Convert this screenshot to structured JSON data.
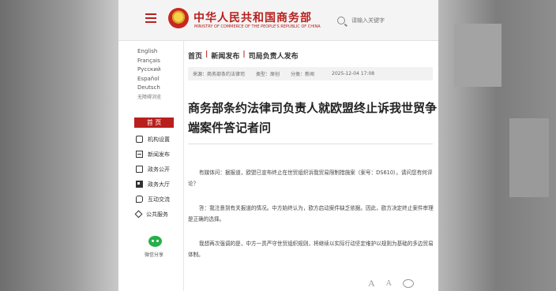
{
  "header": {
    "site_title": "中华人民共和国商务部",
    "site_subtitle": "MINISTRY OF COMMERCE OF THE PEOPLE'S REPUBLIC OF CHINA",
    "search_placeholder": "请输入关键字"
  },
  "languages": [
    "English",
    "Français",
    "Русский",
    "Español",
    "Deutsch",
    "无障碍浏览"
  ],
  "sidebar": {
    "home_label": "首 页",
    "items": [
      {
        "label": "机构设置",
        "icon": "org-icon"
      },
      {
        "label": "新闻发布",
        "icon": "news-icon"
      },
      {
        "label": "政务公开",
        "icon": "gov-icon"
      },
      {
        "label": "政务大厅",
        "icon": "hall-icon"
      },
      {
        "label": "互动交流",
        "icon": "chat-icon"
      },
      {
        "label": "公共服务",
        "icon": "public-icon"
      }
    ],
    "wechat_label": "微信分享"
  },
  "breadcrumb": [
    "首页",
    "新闻发布",
    "司局负责人发布"
  ],
  "breadcrumb_sep": "|",
  "meta": {
    "source": "来源：商务部条约法律司",
    "type": "类型：原创",
    "category": "分类：新闻",
    "date": "2025-12-04 17:08"
  },
  "article": {
    "title": "商务部条约法律司负责人就欧盟终止诉我世贸争端案件答记者问",
    "paragraphs": [
      "有媒体问：据报道，欧盟已宣布终止在世贸组织诉我贸易限制措施案（案号：DS610）。请问您有何评论？",
      "答：我注意到有关报道的情况。中方始终认为，欧方启动案件缺乏依据。因此，欧方决定终止案件审理是正确的选择。",
      "我想再次强调的是，中方一贯严守世贸组织规则，将继续以实际行动坚定维护以规则为基础的多边贸易体制。"
    ]
  },
  "tools": {
    "font_large": "A",
    "font_small": "A"
  },
  "colors": {
    "brand_red": "#b8201e",
    "wechat_green": "#26b04b"
  }
}
